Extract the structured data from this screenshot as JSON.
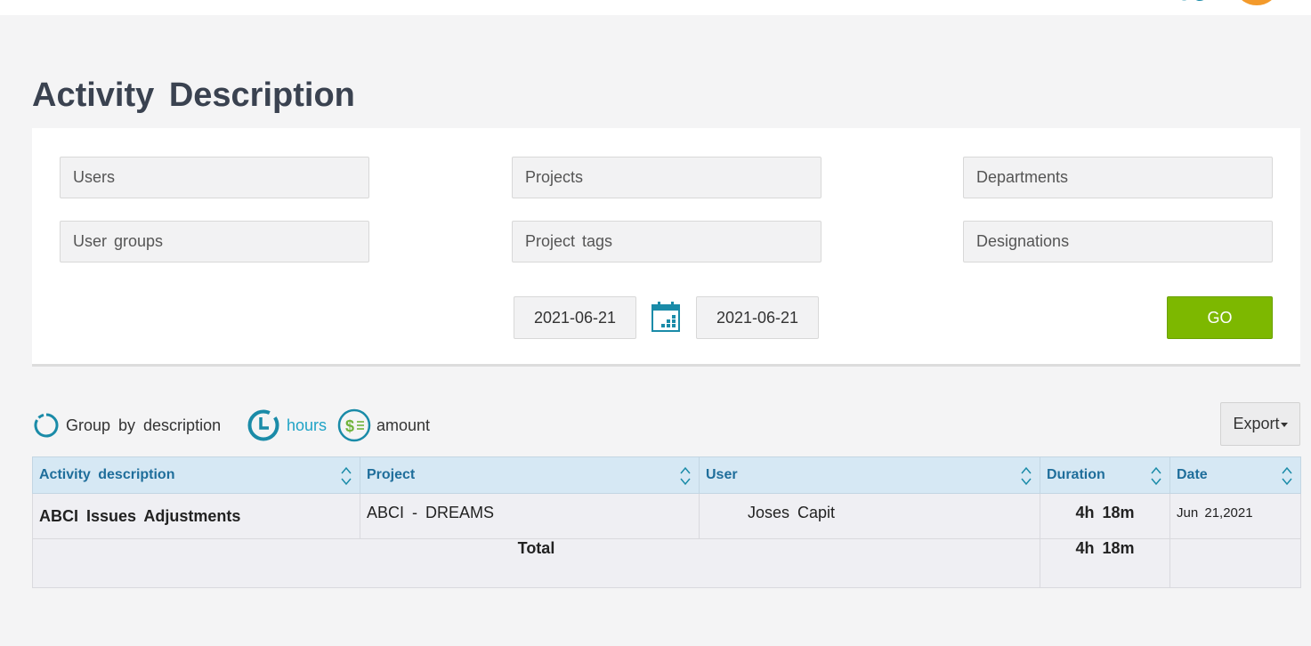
{
  "page": {
    "title": "Activity Description"
  },
  "filters": {
    "users": "Users",
    "projects": "Projects",
    "departments": "Departments",
    "user_groups": "User groups",
    "project_tags": "Project tags",
    "designations": "Designations",
    "date_from": "2021-06-21",
    "date_to": "2021-06-21",
    "go_label": "GO"
  },
  "toolbar": {
    "group_by_label": "Group by description",
    "hours_label": "hours",
    "amount_label": "amount",
    "export_label": "Export"
  },
  "table": {
    "columns": [
      "Activity description",
      "Project",
      "User",
      "Duration",
      "Date"
    ],
    "rows": [
      {
        "description": "ABCI Issues Adjustments",
        "project": "ABCI - DREAMS",
        "user": "Joses Capit",
        "duration": "4h 18m",
        "date": "Jun 21,2021"
      }
    ],
    "total_label": "Total",
    "total_duration": "4h 18m"
  },
  "colors": {
    "accent_blue": "#1a8ba8",
    "go_green": "#7db800",
    "amount_green": "#6fb33b",
    "avatar_orange": "#f39a2b",
    "title_text": "#3a4250"
  },
  "icons": {
    "calendar": "calendar-icon",
    "group": "circle-progress-icon",
    "hours": "clock-icon",
    "amount": "dollar-icon",
    "sort": "sort-icon"
  }
}
